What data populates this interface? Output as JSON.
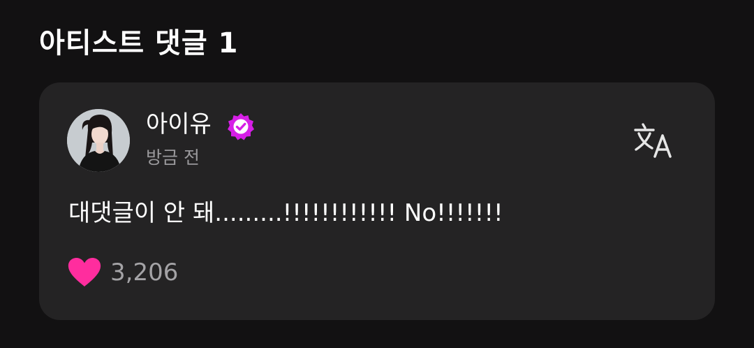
{
  "section": {
    "title": "아티스트 댓글 1"
  },
  "comment": {
    "author": "아이유",
    "verified_icon": "verified-badge-icon",
    "timestamp": "방금 전",
    "text": "대댓글이 안 돼.........!!!!!!!!!!!! No!!!!!!!",
    "translate_icon": "translate-icon",
    "like_icon": "heart-icon",
    "like_count": "3,206"
  },
  "colors": {
    "background": "#121112",
    "card": "#242324",
    "verified": "#d61fe6",
    "heart": "#ff2d9e",
    "secondary_text": "#9a999c"
  }
}
